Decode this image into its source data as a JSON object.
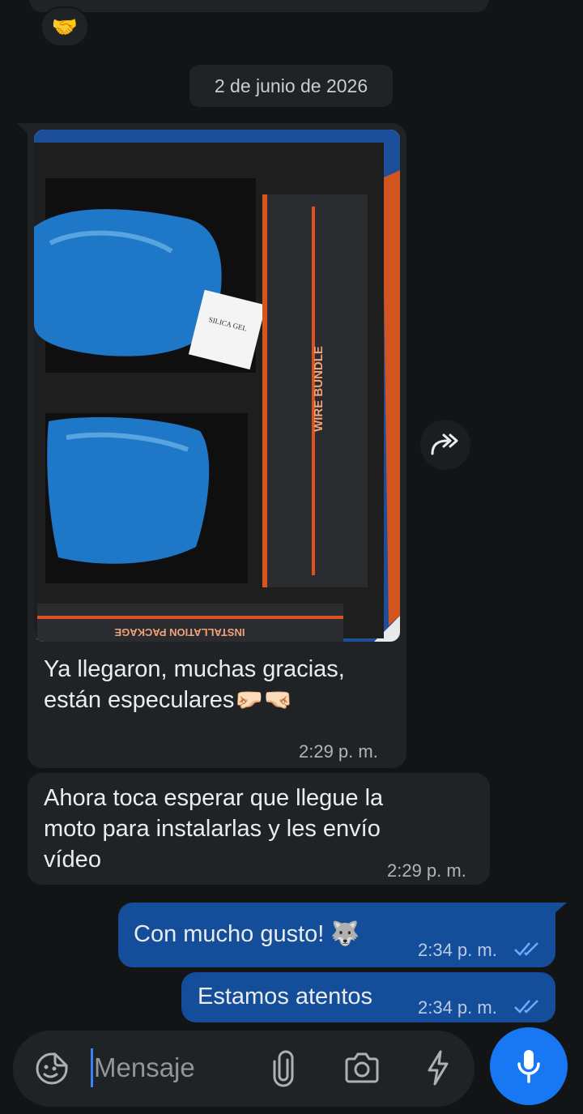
{
  "header_partial": {
    "reaction_emoji": "🤝"
  },
  "date_separator": "2 de junio de 2026",
  "messages": [
    {
      "direction": "incoming",
      "image": {
        "silica_label": "SILICA GEL",
        "wire_label": "WIRE BUNDLE",
        "package_label": "INSTALLATION PACKAGE"
      },
      "text_line1": "Ya llegaron, muchas gracias,",
      "text_line2": "están especulares🤛🏻🤜🏻",
      "time": "2:29 p. m."
    },
    {
      "direction": "incoming",
      "text_line1": "Ahora toca esperar que llegue la",
      "text_line2": "moto para instalarlas y les envío",
      "text_line3": "vídeo",
      "time": "2:29 p. m."
    },
    {
      "direction": "outgoing",
      "text": "Con mucho gusto! 🐺",
      "time": "2:34 p. m.",
      "status": "read"
    },
    {
      "direction": "outgoing",
      "text": "Estamos atentos",
      "time": "2:34 p. m.",
      "status": "read"
    }
  ],
  "composer": {
    "placeholder": "Mensaje",
    "icons": [
      "sticker-icon",
      "attach-icon",
      "camera-icon",
      "flash-icon",
      "mic-icon"
    ]
  },
  "colors": {
    "background": "#121416",
    "incoming_bubble": "#202326",
    "outgoing_bubble": "#144d9a",
    "accent": "#1877f2",
    "read_ticks": "#6ea8ff"
  }
}
